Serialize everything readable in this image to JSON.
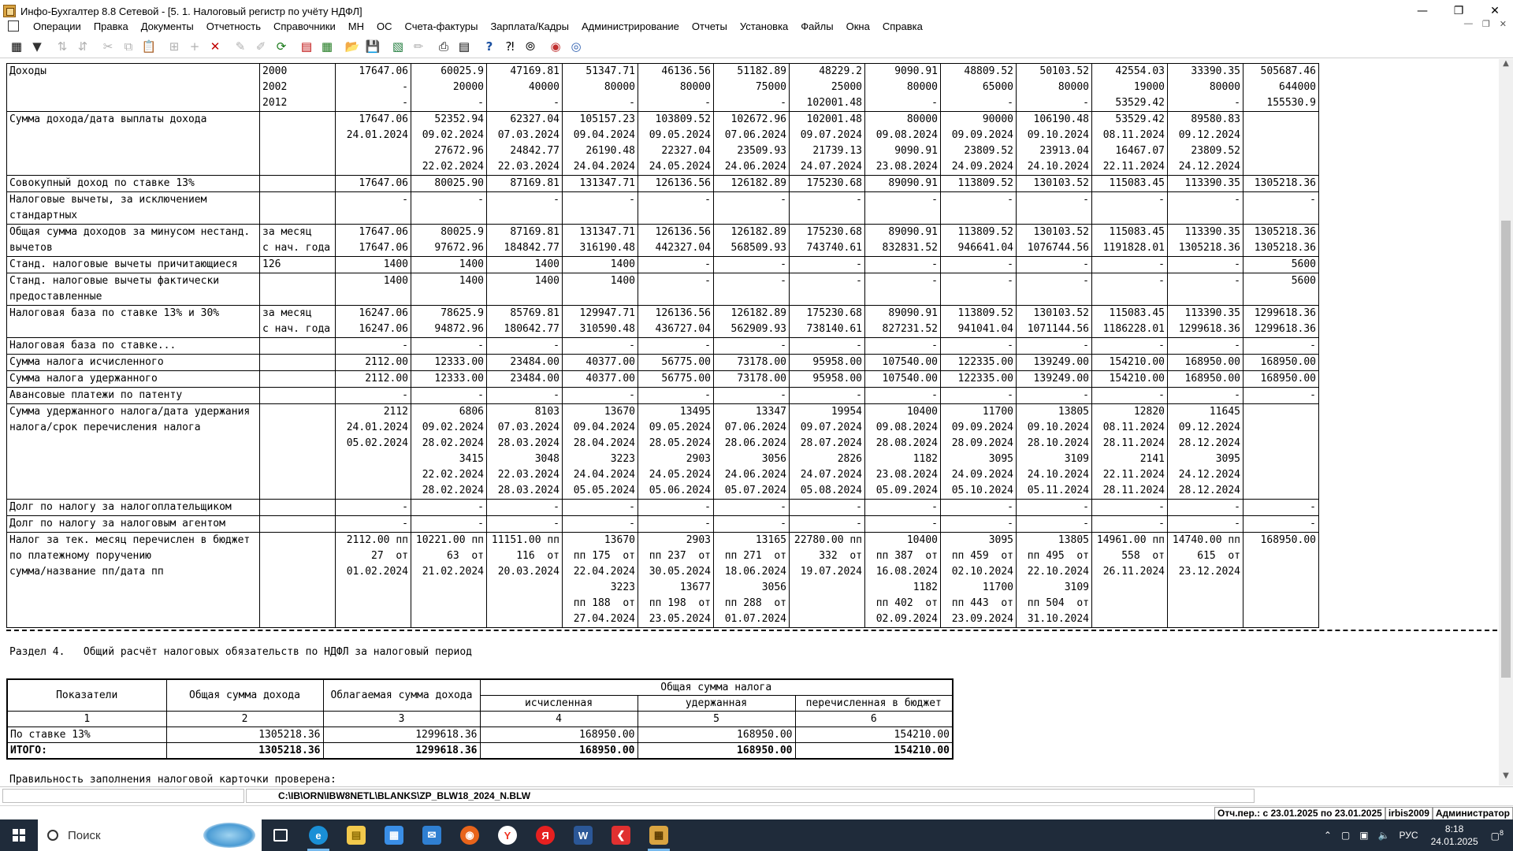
{
  "window": {
    "title": "Инфо-Бухгалтер 8.8 Сетевой - [5. 1. Налоговый регистр по учёту НДФЛ]",
    "controls": [
      "—",
      "❐",
      "✕"
    ]
  },
  "menu": [
    "Операции",
    "Правка",
    "Документы",
    "Отчетность",
    "Справочники",
    "МН",
    "ОС",
    "Счета-фактуры",
    "Зарплата/Кадры",
    "Администрирование",
    "Отчеты",
    "Установка",
    "Файлы",
    "Окна",
    "Справка"
  ],
  "toolbar": [
    "view-icon",
    "filter-icon",
    "sort-asc-icon",
    "sort-desc-icon",
    "cut-icon",
    "copy-icon",
    "paste-icon",
    "insert-icon",
    "add-icon",
    "delete-icon",
    "pen-icon",
    "pen-clear-icon",
    "refresh-icon",
    "pdf-icon",
    "calc-icon",
    "open-icon",
    "save-icon",
    "excel-icon",
    "edit-icon",
    "print-icon",
    "preview-icon",
    "help-icon",
    "context-help-icon",
    "compass-icon",
    "web-icon",
    "globe-icon"
  ],
  "register_rows": [
    {
      "label": [
        "Доходы",
        "",
        ""
      ],
      "code": [
        "2000",
        "2002",
        "2012"
      ],
      "values": [
        [
          "17647.06",
          "-",
          "-"
        ],
        [
          "60025.9",
          "20000",
          "-"
        ],
        [
          "47169.81",
          "40000",
          "-"
        ],
        [
          "51347.71",
          "80000",
          "-"
        ],
        [
          "46136.56",
          "80000",
          "-"
        ],
        [
          "51182.89",
          "75000",
          "-"
        ],
        [
          "48229.2",
          "25000",
          "102001.48"
        ],
        [
          "9090.91",
          "80000",
          "-"
        ],
        [
          "48809.52",
          "65000",
          "-"
        ],
        [
          "50103.52",
          "80000",
          "-"
        ],
        [
          "42554.03",
          "19000",
          "53529.42"
        ],
        [
          "33390.35",
          "80000",
          "-"
        ],
        [
          "505687.46",
          "644000",
          "155530.9"
        ]
      ]
    },
    {
      "label": [
        "Сумма дохода/дата выплаты дохода",
        "",
        "",
        ""
      ],
      "code": [
        "",
        "",
        "",
        ""
      ],
      "values": [
        [
          "17647.06",
          "24.01.2024",
          "",
          ""
        ],
        [
          "52352.94",
          "09.02.2024",
          "27672.96",
          "22.02.2024"
        ],
        [
          "62327.04",
          "07.03.2024",
          "24842.77",
          "22.03.2024"
        ],
        [
          "105157.23",
          "09.04.2024",
          "26190.48",
          "24.04.2024"
        ],
        [
          "103809.52",
          "09.05.2024",
          "22327.04",
          "24.05.2024"
        ],
        [
          "102672.96",
          "07.06.2024",
          "23509.93",
          "24.06.2024"
        ],
        [
          "102001.48",
          "09.07.2024",
          "21739.13",
          "24.07.2024"
        ],
        [
          "80000",
          "09.08.2024",
          "9090.91",
          "23.08.2024"
        ],
        [
          "90000",
          "09.09.2024",
          "23809.52",
          "24.09.2024"
        ],
        [
          "106190.48",
          "09.10.2024",
          "23913.04",
          "24.10.2024"
        ],
        [
          "53529.42",
          "08.11.2024",
          "16467.07",
          "22.11.2024"
        ],
        [
          "89580.83",
          "09.12.2024",
          "23809.52",
          "24.12.2024"
        ],
        [
          "",
          "",
          "",
          ""
        ]
      ]
    },
    {
      "label": [
        "Совокупный доход по ставке 13%"
      ],
      "code": [
        ""
      ],
      "values": [
        [
          "17647.06"
        ],
        [
          "80025.90"
        ],
        [
          "87169.81"
        ],
        [
          "131347.71"
        ],
        [
          "126136.56"
        ],
        [
          "126182.89"
        ],
        [
          "175230.68"
        ],
        [
          "89090.91"
        ],
        [
          "113809.52"
        ],
        [
          "130103.52"
        ],
        [
          "115083.45"
        ],
        [
          "113390.35"
        ],
        [
          "1305218.36"
        ]
      ]
    },
    {
      "label": [
        "Налоговые вычеты, за исключением",
        "стандартных"
      ],
      "code": [
        "",
        ""
      ],
      "values": [
        [
          "-",
          ""
        ],
        [
          "-",
          ""
        ],
        [
          "-",
          ""
        ],
        [
          "-",
          ""
        ],
        [
          "-",
          ""
        ],
        [
          "-",
          ""
        ],
        [
          "-",
          ""
        ],
        [
          "-",
          ""
        ],
        [
          "-",
          ""
        ],
        [
          "-",
          ""
        ],
        [
          "-",
          ""
        ],
        [
          "-",
          ""
        ],
        [
          "-",
          ""
        ]
      ]
    },
    {
      "label": [
        "Общая сумма доходов за минусом нестанд.",
        "вычетов"
      ],
      "code": [
        "за месяц",
        "с нач. года"
      ],
      "values": [
        [
          "17647.06",
          "17647.06"
        ],
        [
          "80025.9",
          "97672.96"
        ],
        [
          "87169.81",
          "184842.77"
        ],
        [
          "131347.71",
          "316190.48"
        ],
        [
          "126136.56",
          "442327.04"
        ],
        [
          "126182.89",
          "568509.93"
        ],
        [
          "175230.68",
          "743740.61"
        ],
        [
          "89090.91",
          "832831.52"
        ],
        [
          "113809.52",
          "946641.04"
        ],
        [
          "130103.52",
          "1076744.56"
        ],
        [
          "115083.45",
          "1191828.01"
        ],
        [
          "113390.35",
          "1305218.36"
        ],
        [
          "1305218.36",
          "1305218.36"
        ]
      ]
    },
    {
      "label": [
        "Станд. налоговые вычеты причитающиеся"
      ],
      "code": [
        "126"
      ],
      "values": [
        [
          "1400"
        ],
        [
          "1400"
        ],
        [
          "1400"
        ],
        [
          "1400"
        ],
        [
          "-"
        ],
        [
          "-"
        ],
        [
          "-"
        ],
        [
          "-"
        ],
        [
          "-"
        ],
        [
          "-"
        ],
        [
          "-"
        ],
        [
          "-"
        ],
        [
          "5600"
        ]
      ]
    },
    {
      "label": [
        "Станд. налоговые вычеты фактически",
        "предоставленные"
      ],
      "code": [
        "",
        ""
      ],
      "values": [
        [
          "1400",
          ""
        ],
        [
          "1400",
          ""
        ],
        [
          "1400",
          ""
        ],
        [
          "1400",
          ""
        ],
        [
          "-",
          ""
        ],
        [
          "-",
          ""
        ],
        [
          "-",
          ""
        ],
        [
          "-",
          ""
        ],
        [
          "-",
          ""
        ],
        [
          "-",
          ""
        ],
        [
          "-",
          ""
        ],
        [
          "-",
          ""
        ],
        [
          "5600",
          ""
        ]
      ]
    },
    {
      "label": [
        "Налоговая база по ставке 13% и 30%",
        ""
      ],
      "code": [
        "за месяц",
        "с нач. года"
      ],
      "values": [
        [
          "16247.06",
          "16247.06"
        ],
        [
          "78625.9",
          "94872.96"
        ],
        [
          "85769.81",
          "180642.77"
        ],
        [
          "129947.71",
          "310590.48"
        ],
        [
          "126136.56",
          "436727.04"
        ],
        [
          "126182.89",
          "562909.93"
        ],
        [
          "175230.68",
          "738140.61"
        ],
        [
          "89090.91",
          "827231.52"
        ],
        [
          "113809.52",
          "941041.04"
        ],
        [
          "130103.52",
          "1071144.56"
        ],
        [
          "115083.45",
          "1186228.01"
        ],
        [
          "113390.35",
          "1299618.36"
        ],
        [
          "1299618.36",
          "1299618.36"
        ]
      ]
    },
    {
      "label": [
        "Налоговая база по ставке..."
      ],
      "code": [
        ""
      ],
      "values": [
        [
          "-"
        ],
        [
          "-"
        ],
        [
          "-"
        ],
        [
          "-"
        ],
        [
          "-"
        ],
        [
          "-"
        ],
        [
          "-"
        ],
        [
          "-"
        ],
        [
          "-"
        ],
        [
          "-"
        ],
        [
          "-"
        ],
        [
          "-"
        ],
        [
          "-"
        ]
      ]
    },
    {
      "label": [
        "Сумма налога исчисленного"
      ],
      "code": [
        ""
      ],
      "values": [
        [
          "2112.00"
        ],
        [
          "12333.00"
        ],
        [
          "23484.00"
        ],
        [
          "40377.00"
        ],
        [
          "56775.00"
        ],
        [
          "73178.00"
        ],
        [
          "95958.00"
        ],
        [
          "107540.00"
        ],
        [
          "122335.00"
        ],
        [
          "139249.00"
        ],
        [
          "154210.00"
        ],
        [
          "168950.00"
        ],
        [
          "168950.00"
        ]
      ]
    },
    {
      "label": [
        "Сумма налога удержанного"
      ],
      "code": [
        ""
      ],
      "values": [
        [
          "2112.00"
        ],
        [
          "12333.00"
        ],
        [
          "23484.00"
        ],
        [
          "40377.00"
        ],
        [
          "56775.00"
        ],
        [
          "73178.00"
        ],
        [
          "95958.00"
        ],
        [
          "107540.00"
        ],
        [
          "122335.00"
        ],
        [
          "139249.00"
        ],
        [
          "154210.00"
        ],
        [
          "168950.00"
        ],
        [
          "168950.00"
        ]
      ]
    },
    {
      "label": [
        "Авансовые платежи по патенту"
      ],
      "code": [
        ""
      ],
      "values": [
        [
          "-"
        ],
        [
          "-"
        ],
        [
          "-"
        ],
        [
          "-"
        ],
        [
          "-"
        ],
        [
          "-"
        ],
        [
          "-"
        ],
        [
          "-"
        ],
        [
          "-"
        ],
        [
          "-"
        ],
        [
          "-"
        ],
        [
          "-"
        ],
        [
          "-"
        ]
      ]
    },
    {
      "label": [
        "Сумма удержанного налога/дата удержания",
        "налога/срок перечисления налога",
        "",
        "",
        "",
        ""
      ],
      "code": [
        "",
        "",
        "",
        "",
        "",
        ""
      ],
      "values": [
        [
          "2112",
          "24.01.2024",
          "05.02.2024",
          "",
          "",
          ""
        ],
        [
          "6806",
          "09.02.2024",
          "28.02.2024",
          "3415",
          "22.02.2024",
          "28.02.2024"
        ],
        [
          "8103",
          "07.03.2024",
          "28.03.2024",
          "3048",
          "22.03.2024",
          "28.03.2024"
        ],
        [
          "13670",
          "09.04.2024",
          "28.04.2024",
          "3223",
          "24.04.2024",
          "05.05.2024"
        ],
        [
          "13495",
          "09.05.2024",
          "28.05.2024",
          "2903",
          "24.05.2024",
          "05.06.2024"
        ],
        [
          "13347",
          "07.06.2024",
          "28.06.2024",
          "3056",
          "24.06.2024",
          "05.07.2024"
        ],
        [
          "19954",
          "09.07.2024",
          "28.07.2024",
          "2826",
          "24.07.2024",
          "05.08.2024"
        ],
        [
          "10400",
          "09.08.2024",
          "28.08.2024",
          "1182",
          "23.08.2024",
          "05.09.2024"
        ],
        [
          "11700",
          "09.09.2024",
          "28.09.2024",
          "3095",
          "24.09.2024",
          "05.10.2024"
        ],
        [
          "13805",
          "09.10.2024",
          "28.10.2024",
          "3109",
          "24.10.2024",
          "05.11.2024"
        ],
        [
          "12820",
          "08.11.2024",
          "28.11.2024",
          "2141",
          "22.11.2024",
          "28.11.2024"
        ],
        [
          "11645",
          "09.12.2024",
          "28.12.2024",
          "3095",
          "24.12.2024",
          "28.12.2024"
        ],
        [
          "",
          "",
          "",
          "",
          "",
          ""
        ]
      ]
    },
    {
      "label": [
        "Долг по налогу за налогоплательщиком"
      ],
      "code": [
        ""
      ],
      "values": [
        [
          "-"
        ],
        [
          "-"
        ],
        [
          "-"
        ],
        [
          "-"
        ],
        [
          "-"
        ],
        [
          "-"
        ],
        [
          "-"
        ],
        [
          "-"
        ],
        [
          "-"
        ],
        [
          "-"
        ],
        [
          "-"
        ],
        [
          "-"
        ],
        [
          "-"
        ]
      ]
    },
    {
      "label": [
        "Долг по налогу за налоговым агентом"
      ],
      "code": [
        ""
      ],
      "values": [
        [
          "-"
        ],
        [
          "-"
        ],
        [
          "-"
        ],
        [
          "-"
        ],
        [
          "-"
        ],
        [
          "-"
        ],
        [
          "-"
        ],
        [
          "-"
        ],
        [
          "-"
        ],
        [
          "-"
        ],
        [
          "-"
        ],
        [
          "-"
        ],
        [
          "-"
        ]
      ]
    },
    {
      "label": [
        "Налог за тек. месяц перечислен в бюджет",
        "по платежному поручению",
        "сумма/название пп/дата пп",
        "",
        "",
        ""
      ],
      "code": [
        "",
        "",
        "",
        "",
        "",
        ""
      ],
      "values": [
        [
          "2112.00 пп",
          "27  от",
          "01.02.2024",
          "",
          "",
          ""
        ],
        [
          "10221.00 пп",
          "63  от",
          "21.02.2024",
          "",
          "",
          ""
        ],
        [
          "11151.00 пп",
          "116  от",
          "20.03.2024",
          "",
          "",
          ""
        ],
        [
          "13670",
          "пп 175  от",
          "22.04.2024",
          "3223",
          "пп 188  от",
          "27.04.2024"
        ],
        [
          "2903",
          "пп 237  от",
          "30.05.2024",
          "13677",
          "пп 198  от",
          "23.05.2024"
        ],
        [
          "13165",
          "пп 271  от",
          "18.06.2024",
          "3056",
          "пп 288  от",
          "01.07.2024"
        ],
        [
          "22780.00 пп",
          "332  от",
          "19.07.2024",
          "",
          "",
          ""
        ],
        [
          "10400",
          "пп 387  от",
          "16.08.2024",
          "1182",
          "пп 402  от",
          "02.09.2024"
        ],
        [
          "3095",
          "пп 459  от",
          "02.10.2024",
          "11700",
          "пп 443  от",
          "23.09.2024"
        ],
        [
          "13805",
          "пп 495  от",
          "22.10.2024",
          "3109",
          "пп 504  от",
          "31.10.2024"
        ],
        [
          "14961.00 пп",
          "558  от",
          "26.11.2024",
          "",
          "",
          ""
        ],
        [
          "14740.00 пп",
          "615  от",
          "23.12.2024",
          "",
          "",
          ""
        ],
        [
          "168950.00",
          "",
          "",
          "",
          "",
          ""
        ]
      ]
    }
  ],
  "section4": {
    "title": "Раздел 4.   Общий расчёт налоговых обязательств по НДФЛ за налоговый период",
    "headers": {
      "indicators": "Показатели",
      "total_income": "Общая сумма дохода",
      "taxable_income": "Облагаемая сумма дохода",
      "tax_total": "Общая сумма налога",
      "calculated": "исчисленная",
      "withheld": "удержанная",
      "transferred": "перечисленная в бюджет"
    },
    "col_numbers": [
      "1",
      "2",
      "3",
      "4",
      "5",
      "6"
    ],
    "rows": [
      {
        "name": "По ставке 13%",
        "cells": [
          "1305218.36",
          "1299618.36",
          "168950.00",
          "168950.00",
          "154210.00"
        ]
      },
      {
        "name": "ИТОГО:",
        "cells": [
          "1305218.36",
          "1299618.36",
          "168950.00",
          "168950.00",
          "154210.00"
        ]
      }
    ],
    "verified": "Правильность заполнения налоговой карточки проверена:"
  },
  "status": {
    "path": "C:\\IB\\ORN\\IBW8NETL\\BLANKS\\ZP_BLW18_2024_N.BLW",
    "period": "Отч.пер.: с 23.01.2025 по 23.01.2025",
    "db": "irbis2009",
    "user": "Администратор"
  },
  "taskbar": {
    "search_placeholder": "Поиск",
    "apps": [
      "task-view-icon",
      "edge-icon",
      "explorer-icon",
      "store-icon",
      "mail-icon",
      "firefox-icon",
      "yandex-browser-icon",
      "yandex-icon",
      "word-icon",
      "anydesk-icon",
      "infobuh-icon"
    ],
    "lang": "РУС",
    "time": "8:18",
    "date": "24.01.2025",
    "notif_count": "8"
  }
}
